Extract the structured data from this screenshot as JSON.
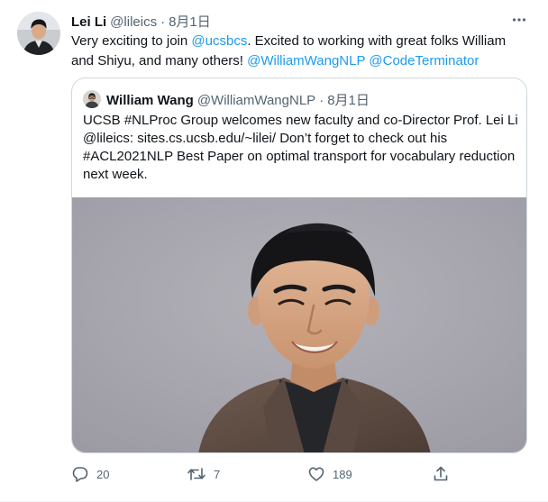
{
  "tweet": {
    "author": {
      "name": "Lei Li",
      "handle": "@lileics",
      "date": "8月1日"
    },
    "separator": "·",
    "text": {
      "prefix": "Very exciting to join ",
      "mention_ucsbcs": "@ucsbcs",
      "middle": ". Excited to working with great folks William and Shiyu, and many others! ",
      "mention_william": "@WilliamWangNLP",
      "space": " ",
      "mention_codeterminator": "@CodeTerminator"
    },
    "more_icon": "more-horizontal-icon"
  },
  "quoted": {
    "author": {
      "name": "William Wang",
      "handle": "@WilliamWangNLP",
      "date": "8月1日"
    },
    "text": "UCSB #NLProc Group welcomes new faculty and co-Director Prof. Lei Li @lileics: sites.cs.ucsb.edu/~lilei/ Don’t forget to check out his #ACL2021NLP Best Paper on optimal transport for vocabulary reduction next week.",
    "photo": "portrait-photo"
  },
  "actions": {
    "reply": {
      "icon": "reply-icon",
      "count": "20"
    },
    "retweet": {
      "icon": "retweet-icon",
      "count": "7"
    },
    "like": {
      "icon": "heart-icon",
      "count": "189"
    },
    "share": {
      "icon": "share-icon"
    }
  },
  "colors": {
    "link": "#1d9bf0",
    "secondary_text": "#536471",
    "border": "#cfd9de",
    "photo_background": "#a6a4ac"
  }
}
